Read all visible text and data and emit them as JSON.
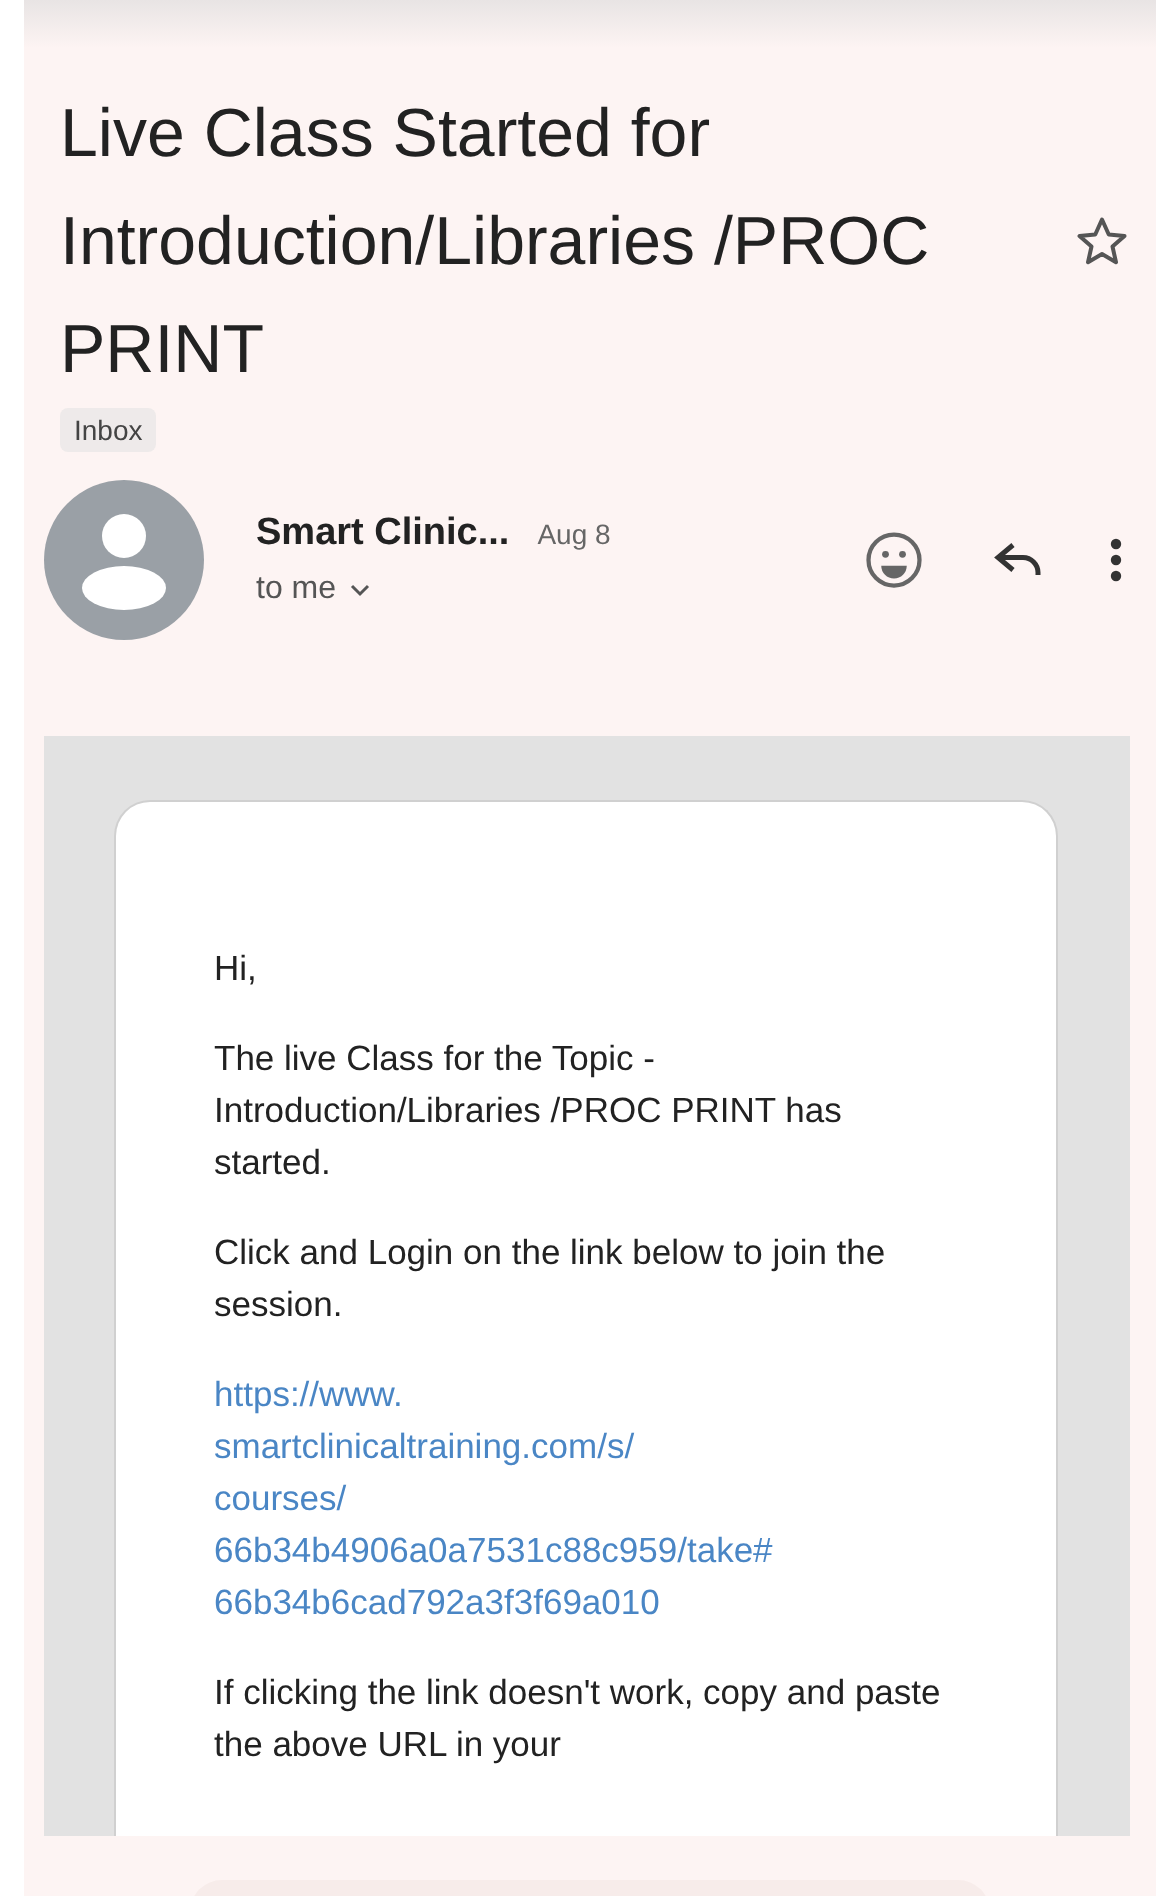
{
  "subject": {
    "title": "Live Class Started for Introduction/Libraries /PROC PRINT",
    "label": "Inbox",
    "starred": false
  },
  "message": {
    "sender": "Smart Clinic...",
    "date": "Aug 8",
    "recipient": "to me"
  },
  "body": {
    "greeting": "Hi,",
    "paragraphs": [
      "The live Class for the Topic - Introduction/Libraries /PROC PRINT has started.",
      "Click and Login on the link below to join the session."
    ],
    "link_lines": [
      "https://www.",
      "smartclinicaltraining.com/s/",
      "courses/",
      "66b34b4906a0a7531c88c959/take#",
      "66b34b6cad792a3f3f69a010"
    ],
    "closing": "If clicking the link doesn't work, copy and paste the above URL in your"
  }
}
